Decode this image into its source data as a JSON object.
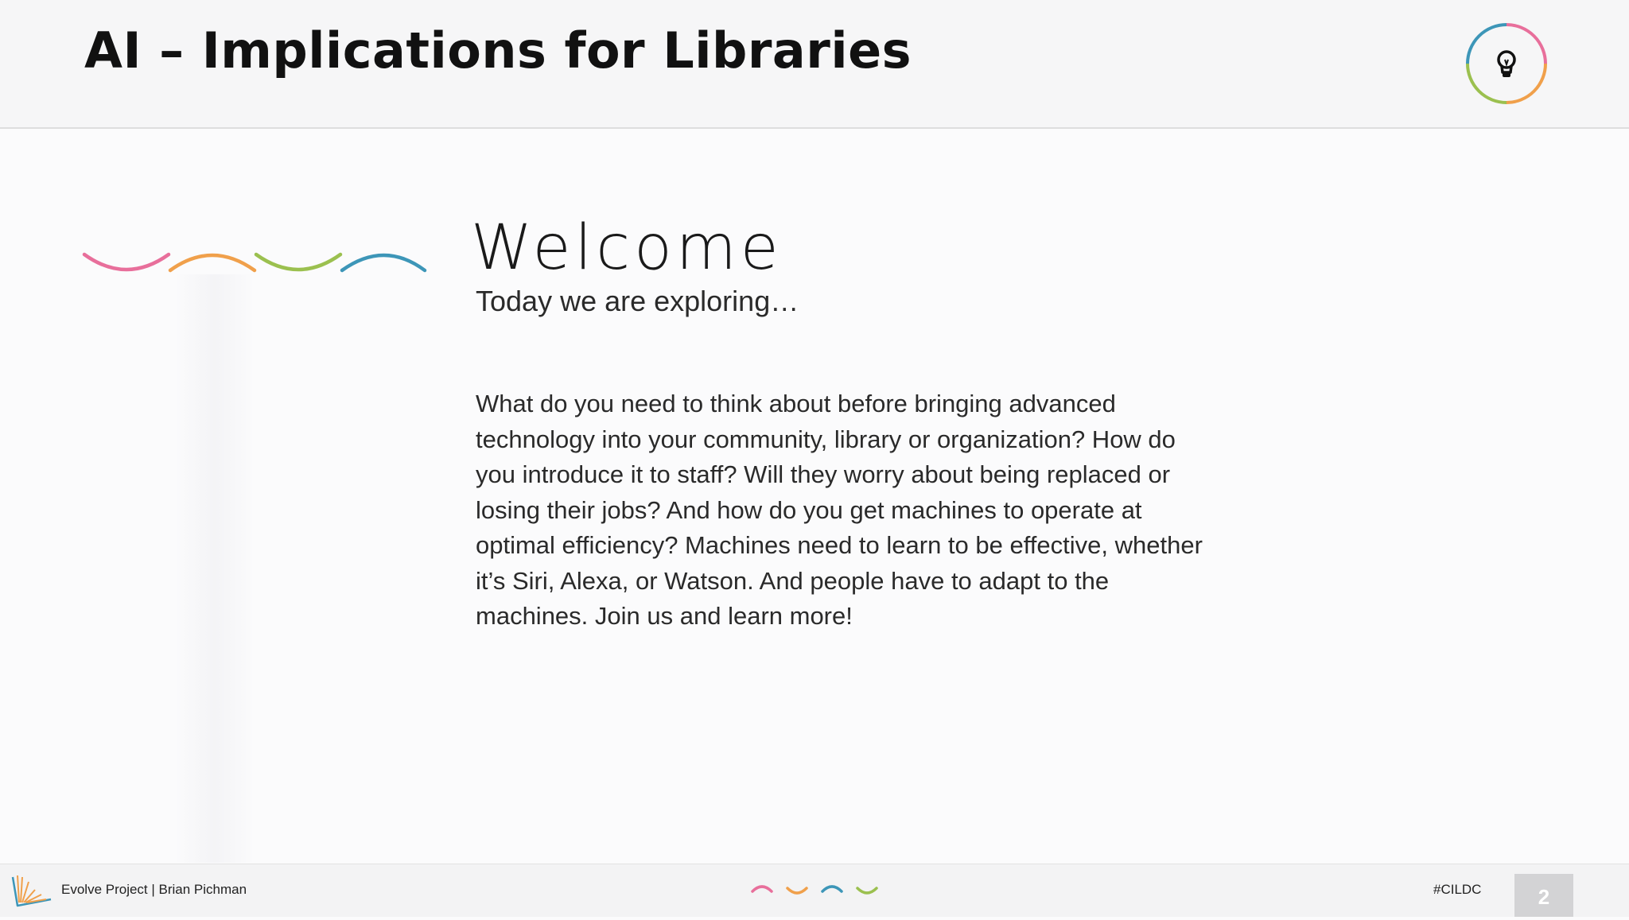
{
  "header": {
    "title": "AI – Implications for Libraries",
    "icon": "lightbulb-icon",
    "ring_colors": [
      "#e86f9b",
      "#f0a04b",
      "#9bc04f",
      "#3d96b8"
    ]
  },
  "main": {
    "heading": "Welcome",
    "subtitle": "Today we are exploring…",
    "body": "What do you need to think about before bringing advanced technology into your community, library or organization? How do you introduce it to staff? Will they worry about being replaced or losing their jobs? And how do you get machines to operate at optimal efficiency? Machines need to learn to be effective, whether it’s Siri, Alexa, or Watson. And people have to adapt to the machines. Join us and learn more!",
    "wave_colors": [
      "#e86f9b",
      "#f0a04b",
      "#9bc04f",
      "#3d96b8"
    ]
  },
  "footer": {
    "left_text": "Evolve Project | Brian Pichman",
    "hashtag": "#CILDC",
    "page_number": "2",
    "wave_colors": [
      "#e86f9b",
      "#f0a04b",
      "#3d96b8",
      "#9bc04f"
    ]
  }
}
